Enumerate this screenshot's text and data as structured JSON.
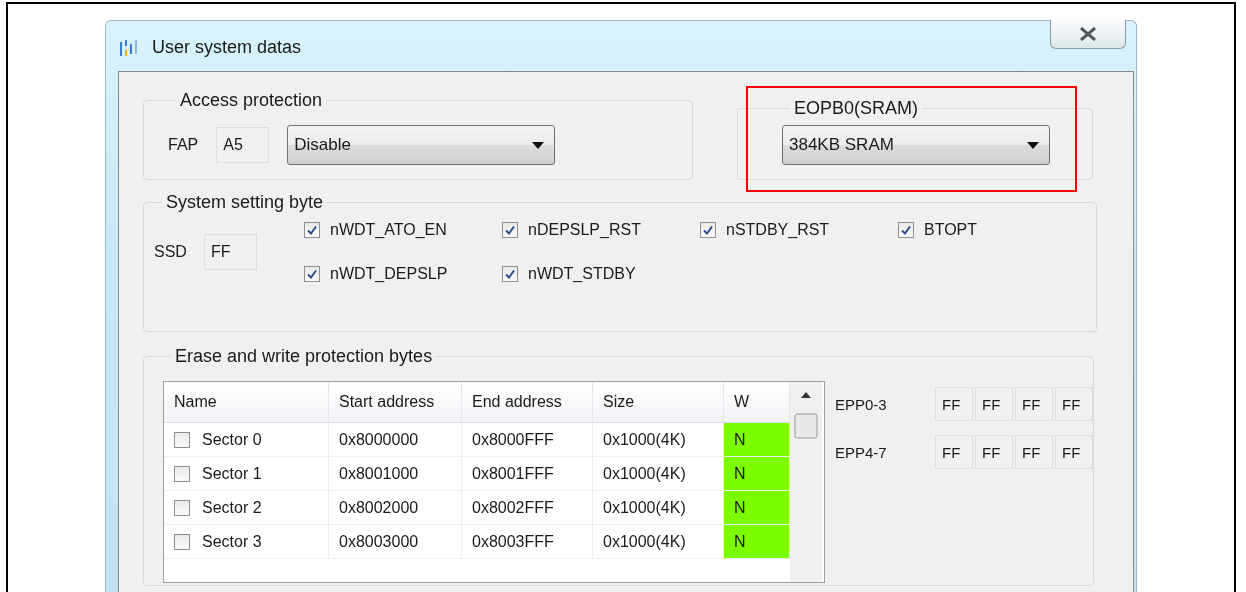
{
  "window": {
    "title": "User system datas"
  },
  "access_protection": {
    "title": "Access protection",
    "fap_label": "FAP",
    "fap_value": "A5",
    "mode": "Disable"
  },
  "eopb0": {
    "title": "EOPB0(SRAM)",
    "value": "384KB SRAM",
    "highlighted": true
  },
  "system_setting": {
    "title": "System setting byte",
    "ssd_label": "SSD",
    "ssd_value": "FF",
    "options": [
      {
        "label": "nWDT_ATO_EN",
        "checked": true
      },
      {
        "label": "nDEPSLP_RST",
        "checked": true
      },
      {
        "label": "nSTDBY_RST",
        "checked": true
      },
      {
        "label": "BTOPT",
        "checked": true
      },
      {
        "label": "nWDT_DEPSLP",
        "checked": true
      },
      {
        "label": "nWDT_STDBY",
        "checked": true
      }
    ]
  },
  "erase_protection": {
    "title": "Erase and write protection bytes",
    "table": {
      "columns": [
        "Name",
        "Start address",
        "End address",
        "Size",
        "W"
      ],
      "rows": [
        {
          "name": "Sector 0",
          "start": "0x8000000",
          "end": "0x8000FFF",
          "size": "0x1000(4K)",
          "w": "N",
          "checked": false
        },
        {
          "name": "Sector 1",
          "start": "0x8001000",
          "end": "0x8001FFF",
          "size": "0x1000(4K)",
          "w": "N",
          "checked": false
        },
        {
          "name": "Sector 2",
          "start": "0x8002000",
          "end": "0x8002FFF",
          "size": "0x1000(4K)",
          "w": "N",
          "checked": false
        },
        {
          "name": "Sector 3",
          "start": "0x8003000",
          "end": "0x8003FFF",
          "size": "0x1000(4K)",
          "w": "N",
          "checked": false
        }
      ]
    },
    "epp": [
      {
        "label": "EPP0-3",
        "values": [
          "FF",
          "FF",
          "FF",
          "FF"
        ]
      },
      {
        "label": "EPP4-7",
        "values": [
          "FF",
          "FF",
          "FF",
          "FF"
        ]
      }
    ]
  }
}
